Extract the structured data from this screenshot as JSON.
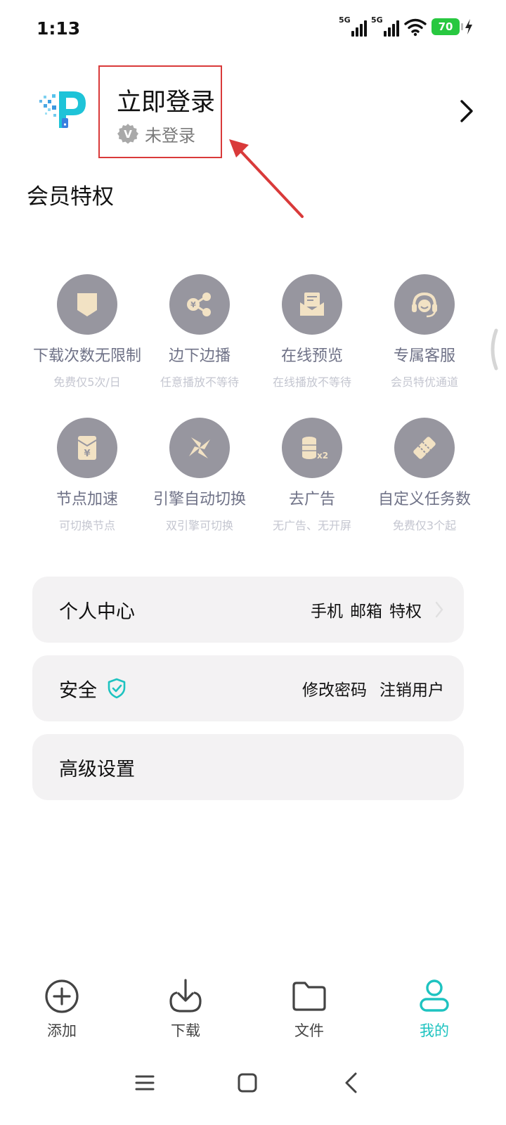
{
  "status_bar": {
    "time": "1:13",
    "sim1": "5G",
    "sim2": "5G",
    "battery": "70"
  },
  "header": {
    "login_title": "立即登录",
    "login_status": "未登录",
    "badge_letter": "V",
    "logo_letter": "P"
  },
  "privileges": {
    "title": "会员特权",
    "items": [
      {
        "title": "下载次数无限制",
        "desc": "免费仅5次/日",
        "icon": "shield-card-icon"
      },
      {
        "title": "边下边播",
        "desc": "任意播放不等待",
        "icon": "share-icon"
      },
      {
        "title": "在线预览",
        "desc": "在线播放不等待",
        "icon": "mail-preview-icon"
      },
      {
        "title": "专属客服",
        "desc": "会员特优通道",
        "icon": "headset-icon"
      },
      {
        "title": "节点加速",
        "desc": "可切换节点",
        "icon": "envelope-yen-icon"
      },
      {
        "title": "引擎自动切换",
        "desc": "双引擎可切换",
        "icon": "pinwheel-icon"
      },
      {
        "title": "去广告",
        "desc": "无广告、无开屏",
        "icon": "coins-x2-icon"
      },
      {
        "title": "自定义任务数",
        "desc": "免费仅3个起",
        "icon": "ticket-icon"
      }
    ],
    "coin_label": "x2",
    "yen_symbol": "¥"
  },
  "menu": {
    "personal": {
      "label": "个人中心",
      "phone": "手机",
      "email": "邮箱",
      "privilege": "特权"
    },
    "security": {
      "label": "安全",
      "change_password": "修改密码",
      "cancel_user": "注销用户"
    },
    "advanced": {
      "label": "高级设置"
    }
  },
  "bottom_nav": {
    "items": [
      {
        "label": "添加",
        "icon": "plus-circle-icon"
      },
      {
        "label": "下载",
        "icon": "download-icon"
      },
      {
        "label": "文件",
        "icon": "folder-icon"
      },
      {
        "label": "我的",
        "icon": "user-icon"
      }
    ],
    "active_color": "#1ec3c0"
  },
  "colors": {
    "privilege_circle": "#97969f",
    "icon_fill": "#f2e2c4",
    "annotation_red": "#d93a3a",
    "accent": "#1ec3c0"
  }
}
